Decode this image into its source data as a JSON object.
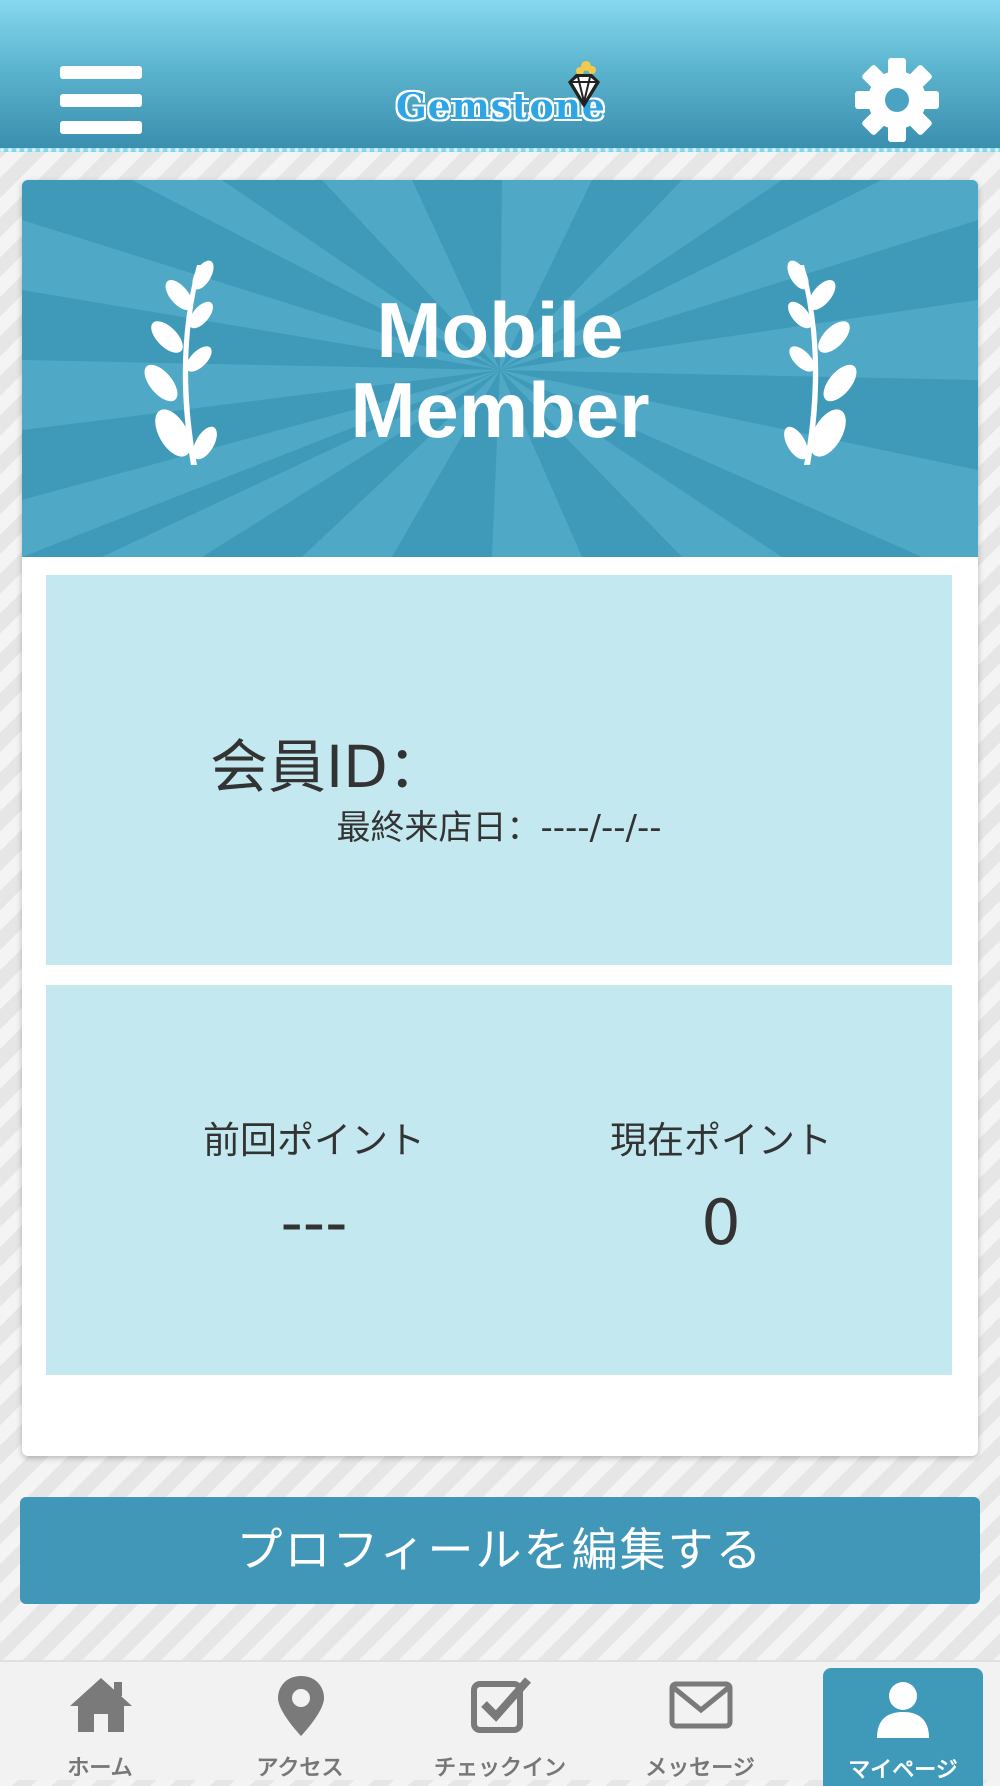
{
  "header": {
    "logo_text": "Gemstone",
    "menu_icon": "hamburger-menu-icon",
    "settings_icon": "gear-icon"
  },
  "banner": {
    "title_line1": "Mobile",
    "title_line2": "Member"
  },
  "member": {
    "id_label": "会員ID：",
    "last_visit": "最終来店日：----/--/--"
  },
  "points": {
    "previous_label": "前回ポイント",
    "previous_value": "---",
    "current_label": "現在ポイント",
    "current_value": "0"
  },
  "actions": {
    "edit_profile": "プロフィールを編集する"
  },
  "nav": {
    "items": [
      {
        "label": "ホーム",
        "icon": "home-icon"
      },
      {
        "label": "アクセス",
        "icon": "map-pin-icon"
      },
      {
        "label": "チェックイン",
        "icon": "checkin-checkbox-icon"
      },
      {
        "label": "メッセージ",
        "icon": "envelope-icon"
      },
      {
        "label": "マイページ",
        "icon": "user-icon",
        "active": true
      }
    ]
  },
  "colors": {
    "header": "#5cb5cf",
    "accent": "#3f9ab9",
    "panel": "#c3e8f0",
    "logo": "#2ea6e6"
  }
}
